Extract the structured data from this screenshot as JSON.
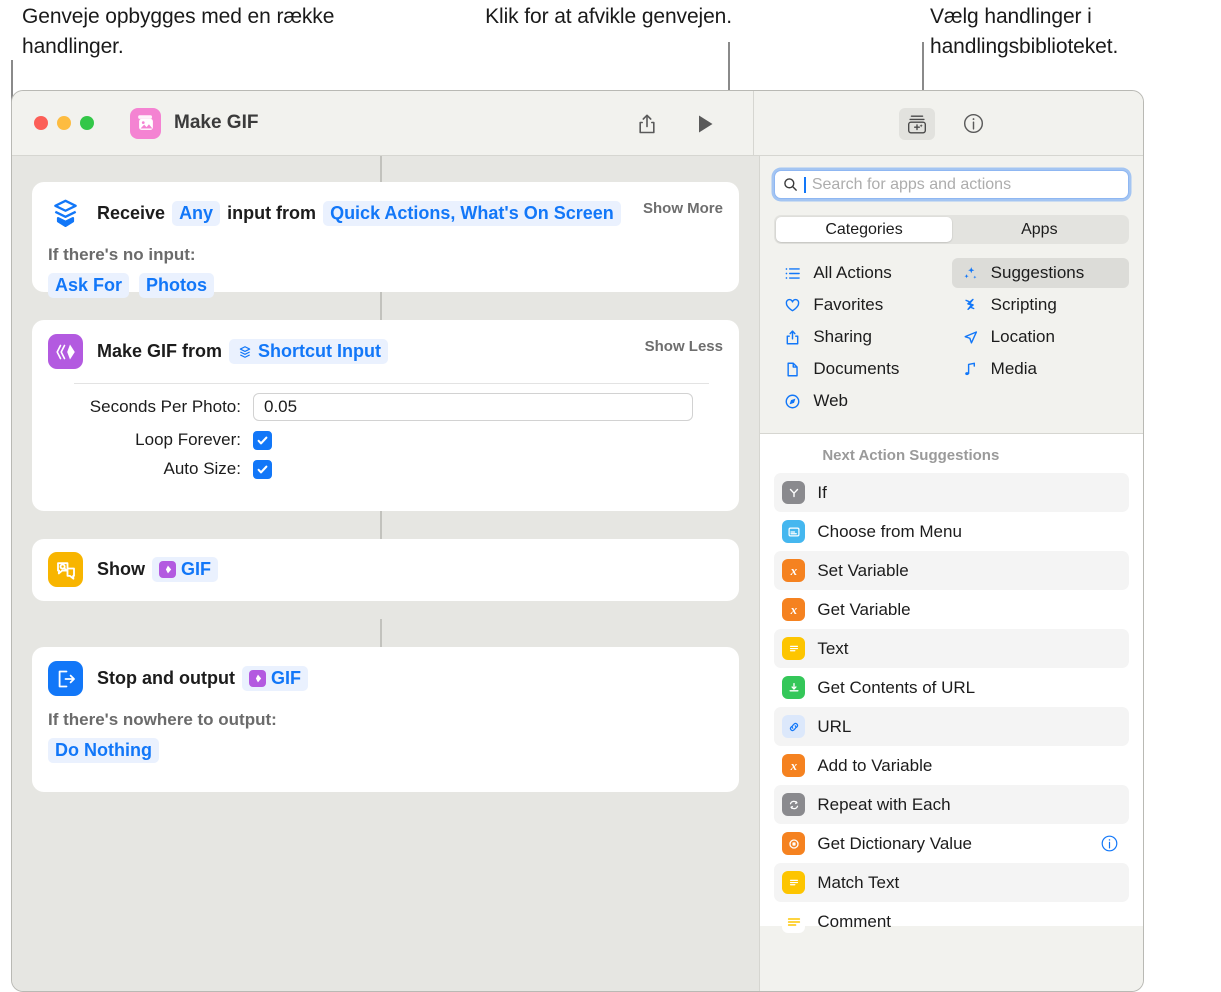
{
  "annotations": {
    "left": "Genveje opbygges med en række handlinger.",
    "middle": "Klik for at afvikle genvejen.",
    "right": "Vælg handlinger i handlingsbiblioteket."
  },
  "window": {
    "title": "Make GIF",
    "app_icon": "photos-stack-icon",
    "traffic_lights": [
      "close",
      "minimize",
      "zoom"
    ],
    "toolbar": {
      "share_label": "share-icon",
      "run_label": "play-icon",
      "library_label": "action-library-icon",
      "info_label": "info-icon"
    }
  },
  "actions": [
    {
      "icon": "receive-input-icon",
      "icon_color": "#1277f8",
      "prefix": "Receive",
      "token1": "Any",
      "middle": "input from",
      "token2": "Quick Actions, What's On Screen",
      "disclosure": "Show More",
      "sub_label": "If there's no input:",
      "sub_tokens": [
        "Ask For",
        "Photos"
      ]
    },
    {
      "icon": "make-gif-icon",
      "icon_color": "#b35ae0",
      "prefix": "Make GIF from",
      "token_icon": "shortcut-input-icon",
      "token1": "Shortcut Input",
      "disclosure": "Show Less",
      "fields": [
        {
          "label": "Seconds Per Photo:",
          "type": "text",
          "value": "0.05"
        },
        {
          "label": "Loop Forever:",
          "type": "checkbox",
          "value": true
        },
        {
          "label": "Auto Size:",
          "type": "checkbox",
          "value": true
        }
      ]
    },
    {
      "icon": "show-result-icon",
      "icon_color": "#f8b500",
      "prefix": "Show",
      "token1": "GIF",
      "token_mini_color": "#b35ae0"
    },
    {
      "icon": "stop-output-icon",
      "icon_color": "#1277f8",
      "prefix": "Stop and output",
      "token1": "GIF",
      "token_mini_color": "#b35ae0",
      "sub_label": "If there's nowhere to output:",
      "sub_tokens": [
        "Do Nothing"
      ]
    }
  ],
  "sidebar": {
    "search": {
      "placeholder": "Search for apps and actions",
      "value": ""
    },
    "tabs": [
      {
        "label": "Categories",
        "selected": true
      },
      {
        "label": "Apps",
        "selected": false
      }
    ],
    "categories": [
      {
        "label": "All Actions",
        "icon": "list-icon",
        "selected": false
      },
      {
        "label": "Suggestions",
        "icon": "sparkles-icon",
        "selected": true
      },
      {
        "label": "Favorites",
        "icon": "heart-icon",
        "selected": false
      },
      {
        "label": "Scripting",
        "icon": "scripting-icon",
        "selected": false
      },
      {
        "label": "Sharing",
        "icon": "share-icon",
        "selected": false
      },
      {
        "label": "Location",
        "icon": "location-icon",
        "selected": false
      },
      {
        "label": "Documents",
        "icon": "document-icon",
        "selected": false
      },
      {
        "label": "Media",
        "icon": "music-note-icon",
        "selected": false
      },
      {
        "label": "Web",
        "icon": "compass-icon",
        "selected": false
      }
    ],
    "suggestions_title": "Next Action Suggestions",
    "suggestions": [
      {
        "label": "If",
        "icon": "branch-icon",
        "color": "#8a8a8e",
        "info": false
      },
      {
        "label": "Choose from Menu",
        "icon": "menu-icon",
        "color": "#45b7ef",
        "info": false
      },
      {
        "label": "Set Variable",
        "icon": "variable-icon",
        "color": "#f58220",
        "info": false
      },
      {
        "label": "Get Variable",
        "icon": "variable-icon",
        "color": "#f58220",
        "info": false
      },
      {
        "label": "Text",
        "icon": "text-icon",
        "color": "#fdc500",
        "info": false
      },
      {
        "label": "Get Contents of URL",
        "icon": "download-icon",
        "color": "#34c759",
        "info": false
      },
      {
        "label": "URL",
        "icon": "link-icon",
        "color": "#dce8fb",
        "info": false
      },
      {
        "label": "Add to Variable",
        "icon": "variable-icon",
        "color": "#f58220",
        "info": false
      },
      {
        "label": "Repeat with Each",
        "icon": "repeat-icon",
        "color": "#8a8a8e",
        "info": false
      },
      {
        "label": "Get Dictionary Value",
        "icon": "dictionary-icon",
        "color": "#f58220",
        "info": true
      },
      {
        "label": "Match Text",
        "icon": "text-icon",
        "color": "#fdc500",
        "info": false
      },
      {
        "label": "Comment",
        "icon": "comment-icon",
        "color": "#ffffff",
        "info": false
      }
    ]
  },
  "colors": {
    "accent_blue": "#1277f8",
    "canvas_bg": "#e6e6e2",
    "chrome_bg": "#f2f2ee",
    "card_bg": "#ffffff"
  }
}
